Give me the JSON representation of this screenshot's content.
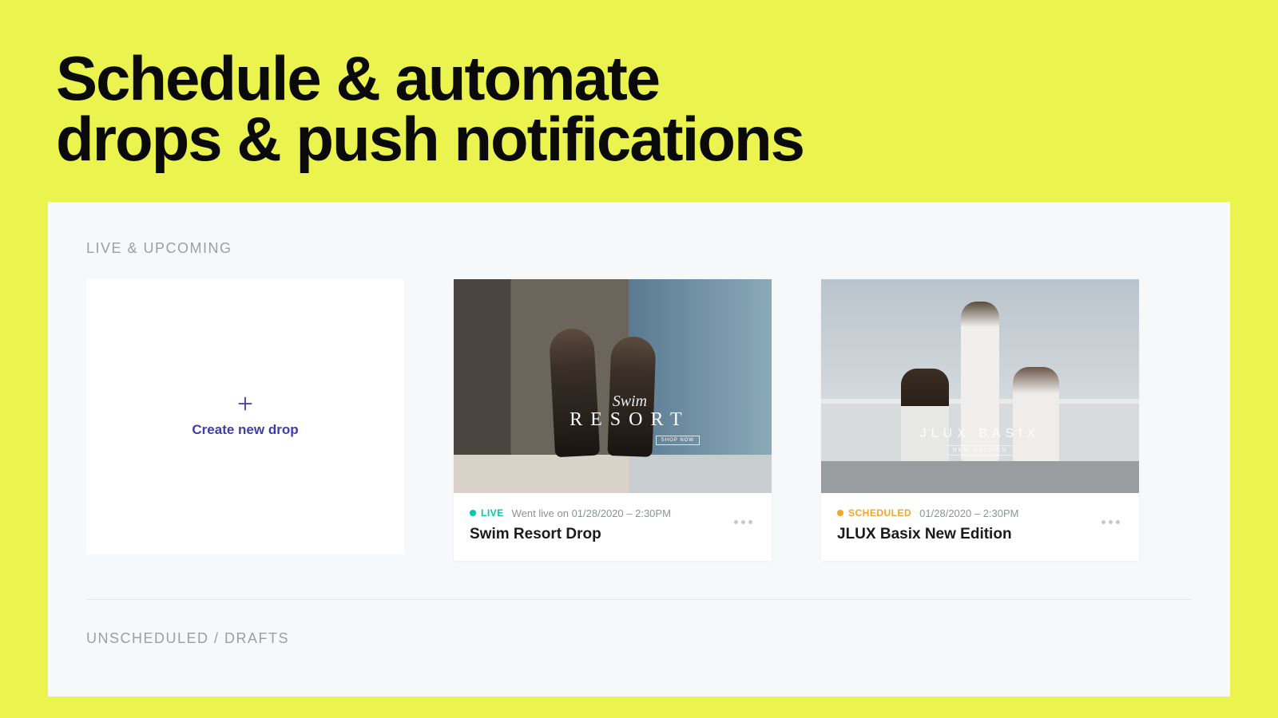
{
  "hero": {
    "line1": "Schedule & automate",
    "line2": "drops & push notifications"
  },
  "sections": {
    "live_upcoming_label": "LIVE & UPCOMING",
    "drafts_label": "UNSCHEDULED / DRAFTS"
  },
  "create_card": {
    "label": "Create new drop"
  },
  "drops": [
    {
      "status": "LIVE",
      "status_type": "live",
      "date_text": "Went live on 01/28/2020 – 2:30PM",
      "title": "Swim Resort Drop",
      "image_overlay": {
        "script": "Swim",
        "main": "RESORT",
        "button": "SHOP NOW"
      }
    },
    {
      "status": "SCHEDULED",
      "status_type": "scheduled",
      "date_text": "01/28/2020 – 2:30PM",
      "title": "JLUX Basix New Edition",
      "image_overlay": {
        "main": "JLUX BASIX",
        "sub": "NEW EDITION"
      }
    }
  ]
}
